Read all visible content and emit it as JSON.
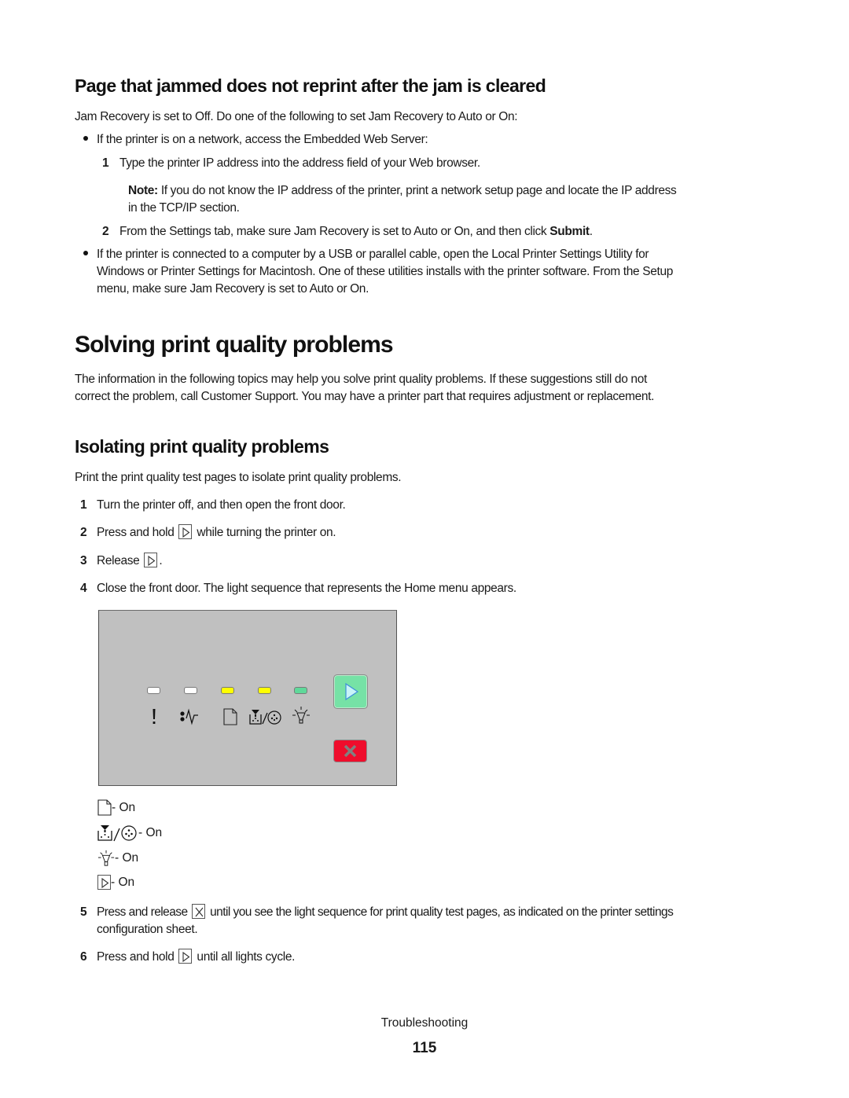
{
  "section_jam": {
    "title": "Page that jammed does not reprint after the jam is cleared",
    "intro": "Jam Recovery is set to Off. Do one of the following to set Jam Recovery to Auto or On:",
    "bullet1": "If the printer is on a network, access the Embedded Web Server:",
    "step1_num": "1",
    "step1": "Type the printer IP address into the address field of your Web browser.",
    "note_label": "Note:",
    "note_line1": " If you do not know the IP address of the printer, print a network setup page and locate the IP address",
    "note_line2": "in the TCP/IP section.",
    "step2_num": "2",
    "step2_pre": "From the Settings tab, make sure Jam Recovery is set to Auto or On, and then click ",
    "step2_bold": "Submit",
    "step2_post": ".",
    "bullet2_line1": "If the printer is connected to a computer by a USB or parallel cable, open the Local Printer Settings Utility for",
    "bullet2_line2": "Windows or Printer Settings for Macintosh. One of these utilities installs with the printer software. From the Setup",
    "bullet2_line3": "menu, make sure Jam Recovery is set to Auto or On."
  },
  "section_solving": {
    "title": "Solving print quality problems",
    "para_line1": "The information in the following topics may help you solve print quality problems. If these suggestions still do not",
    "para_line2": "correct the problem, call Customer Support. You may have a printer part that requires adjustment or replacement."
  },
  "section_isolating": {
    "title": "Isolating print quality problems",
    "intro": "Print the print quality test pages to isolate print quality problems.",
    "steps": [
      {
        "num": "1",
        "text": "Turn the printer off, and then open the front door."
      },
      {
        "num": "2",
        "pre": "Press and hold ",
        "post": " while turning the printer on.",
        "icon": "continue-button-icon"
      },
      {
        "num": "3",
        "pre": "Release ",
        "post": ".",
        "icon": "continue-button-icon"
      },
      {
        "num": "4",
        "text": "Close the front door. The light sequence that represents the Home menu appears."
      },
      {
        "num": "5",
        "pre": "Press and release ",
        "post": " until you see the light sequence for print quality test pages, as indicated on the printer settings",
        "line2": "configuration sheet.",
        "icon": "cancel-button-icon"
      },
      {
        "num": "6",
        "pre": "Press and hold ",
        "post": " until all lights cycle.",
        "icon": "continue-button-icon"
      }
    ]
  },
  "control_panel": {
    "leds": [
      {
        "name": "error",
        "icon": "exclamation-icon",
        "state": "off",
        "color": "#ffffff"
      },
      {
        "name": "paper-jam",
        "icon": "paper-jam-icon",
        "state": "off",
        "color": "#ffffff"
      },
      {
        "name": "load-paper",
        "icon": "paper-icon",
        "state": "on",
        "color": "#ffff00"
      },
      {
        "name": "toner-drum",
        "icon": "toner-drum-icon",
        "state": "on",
        "color": "#ffff00"
      },
      {
        "name": "ready",
        "icon": "lightbulb-icon",
        "state": "on",
        "color": "#5fd99a"
      }
    ],
    "buttons": [
      {
        "name": "continue",
        "icon": "play-icon",
        "color": "#76e2a6"
      },
      {
        "name": "cancel",
        "icon": "x-icon",
        "color": "#ef0d2c"
      }
    ]
  },
  "legend": [
    {
      "icon": "paper-icon",
      "label": " - On"
    },
    {
      "icon": "toner-drum-icon",
      "label": " - On"
    },
    {
      "icon": "lightbulb-icon",
      "label": " - On"
    },
    {
      "icon": "continue-button-icon",
      "label": " - On"
    }
  ],
  "footer": {
    "section": "Troubleshooting",
    "page_number": "115"
  }
}
